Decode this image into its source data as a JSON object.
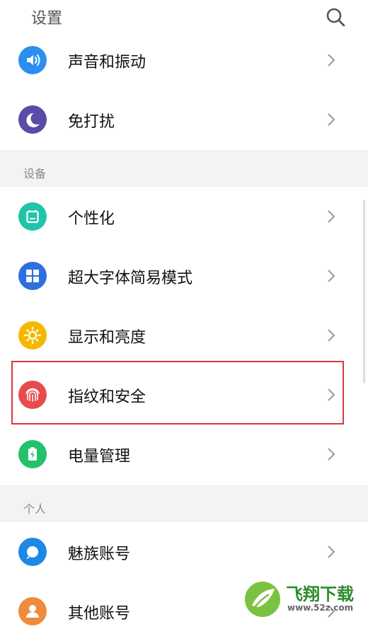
{
  "header": {
    "title": "设置",
    "search_icon": "search-icon"
  },
  "rows_top": [
    {
      "label": "声音和振动",
      "icon": "sound-vibration-icon",
      "color": "#2b8ff2"
    },
    {
      "label": "免打扰",
      "icon": "moon-icon",
      "color": "#5b4aa6"
    }
  ],
  "section_device": {
    "label": "设备"
  },
  "rows_device": [
    {
      "label": "个性化",
      "icon": "personalize-icon",
      "color": "#20c4a8"
    },
    {
      "label": "超大字体简易模式",
      "icon": "grid-icon",
      "color": "#2d6fe0"
    },
    {
      "label": "显示和亮度",
      "icon": "sun-icon",
      "color": "#f5b800"
    },
    {
      "label": "指纹和安全",
      "icon": "fingerprint-icon",
      "color": "#e84b4b"
    },
    {
      "label": "电量管理",
      "icon": "battery-icon",
      "color": "#23c26a"
    }
  ],
  "section_personal": {
    "label": "个人"
  },
  "rows_personal": [
    {
      "label": "魅族账号",
      "icon": "meizu-account-icon",
      "color": "#1e88e5"
    },
    {
      "label": "其他账号",
      "icon": "user-icon",
      "color": "#f08a3c"
    }
  ],
  "watermark": {
    "title": "飞翔下载",
    "url": "www.52z.com"
  },
  "colors": {
    "accent_red": "#d9363e",
    "divider": "#f3f3f3"
  }
}
